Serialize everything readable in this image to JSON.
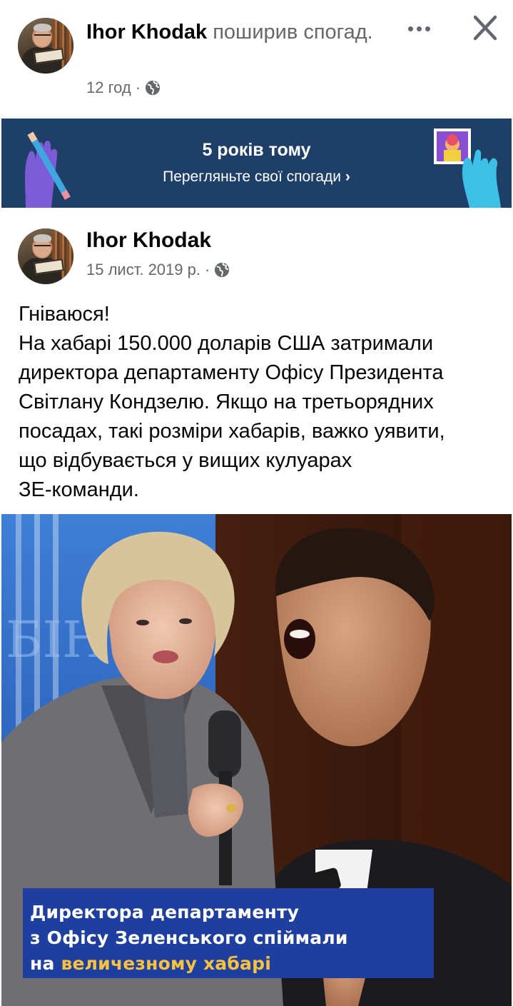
{
  "share_header": {
    "author": "Ihor Khodak",
    "action": " поширив спогад.",
    "time": "12 год",
    "separator": "·"
  },
  "memories_banner": {
    "title": "5 років тому",
    "link": "Перегляньте свої спогади",
    "chevron": "›"
  },
  "post": {
    "author": "Ihor Khodak",
    "date": "15 лист. 2019 р.",
    "separator": "·",
    "text_lines": [
      "Гніваюся!",
      "На хабарі 150.000 доларів США затримали",
      "директора департаменту Офісу Президента",
      "Світлану Кондзелю. Якщо на третьорядних",
      "посадах, такі розміри хабарів, важко уявити,",
      "що відбувається у вищих кулуарах",
      "ЗЕ-команди."
    ],
    "image_caption": {
      "line1": "Директора департаменту",
      "line2": "з Офісу Зеленського спіймали",
      "line3_prefix": "на ",
      "line3_highlight": "величезному хабарі"
    },
    "image_sign_text": "БІН"
  },
  "icons": {
    "privacy": "globe-icon",
    "more": "more-options-icon",
    "close": "close-icon"
  },
  "colors": {
    "banner_bg": "#1e3f68",
    "caption_bg": "#1f3fa0",
    "caption_highlight": "#f6c23e",
    "meta_text": "#65676b"
  }
}
